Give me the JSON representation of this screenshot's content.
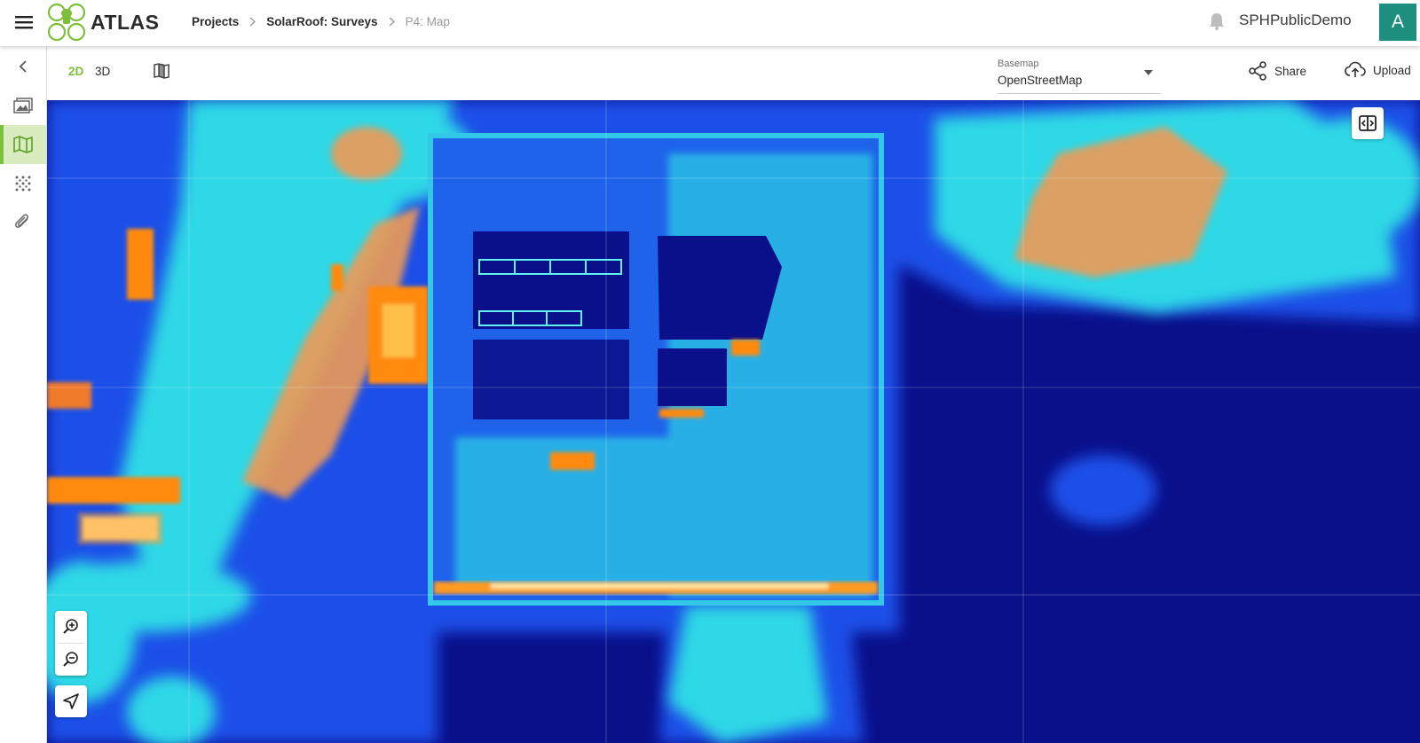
{
  "app": {
    "brand": "ATLAS",
    "menu_icon": "hamburger-menu-icon",
    "logo_icon": "atlas-drone-logo"
  },
  "breadcrumb": {
    "items": [
      "Projects",
      "SolarRoof: Surveys",
      "P4: Map"
    ]
  },
  "header": {
    "username": "SPHPublicDemo",
    "avatar_letter": "A",
    "avatar_color": "#1e8e7e",
    "bell_icon": "bell-icon"
  },
  "sidebar": {
    "items": [
      {
        "name": "collapse",
        "icon": "chevron-left-icon",
        "active": false
      },
      {
        "name": "images",
        "icon": "images-icon",
        "active": false
      },
      {
        "name": "map",
        "icon": "map-icon",
        "active": true
      },
      {
        "name": "pointcloud",
        "icon": "dots-grid-icon",
        "active": false
      },
      {
        "name": "attachments",
        "icon": "paperclip-icon",
        "active": false
      }
    ],
    "active_color": "#7cbf3a"
  },
  "toolbar": {
    "mode_2d": "2D",
    "mode_3d": "3D",
    "active_mode": "2D",
    "layers_icon": "map-layers-icon",
    "basemap_label": "Basemap",
    "basemap_value": "OpenStreetMap",
    "share_label": "Share",
    "upload_label": "Upload"
  },
  "map": {
    "layer": "thermal heatmap",
    "colors": {
      "cold": "#0a0f8a",
      "cool": "#1a4fe8",
      "mid": "#2fd8e6",
      "warm": "#ee8f3a",
      "hot": "#ff7a00"
    },
    "controls": {
      "compare_icon": "split-compare-icon",
      "zoom_in_icon": "zoom-in-icon",
      "zoom_out_icon": "zoom-out-icon",
      "locate_icon": "navigation-arrow-icon"
    }
  }
}
